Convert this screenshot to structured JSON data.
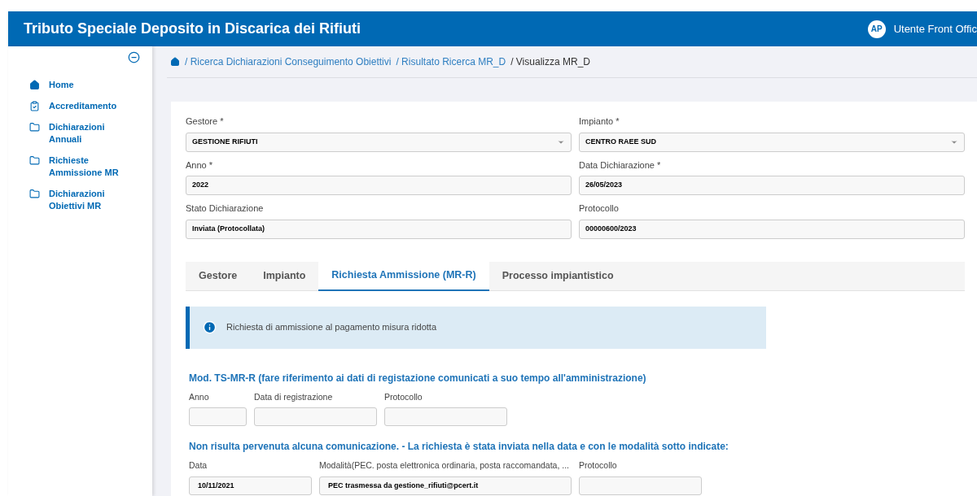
{
  "header": {
    "title": "Tributo Speciale Deposito in Discarica dei Rifiuti",
    "avatar": "AP",
    "user": "Utente Front Offic"
  },
  "sidebar": {
    "items": [
      {
        "label": "Home"
      },
      {
        "label": "Accreditamento"
      },
      {
        "label": "Dichiarazioni Annuali"
      },
      {
        "label": "Richieste Ammissione MR"
      },
      {
        "label": "Dichiarazioni Obiettivi MR"
      }
    ]
  },
  "breadcrumb": {
    "links": [
      "/ Ricerca Dichiarazioni Conseguimento Obiettivi",
      "/ Risultato Ricerca MR_D"
    ],
    "current": "/ Visualizza MR_D"
  },
  "form": {
    "fields": [
      {
        "label": "Gestore *",
        "value": "GESTIONE RIFIUTI",
        "kind": "select"
      },
      {
        "label": "Impianto *",
        "value": "CENTRO RAEE SUD",
        "kind": "select"
      },
      {
        "label": "Anno *",
        "value": "2022",
        "kind": "text"
      },
      {
        "label": "Data Dichiarazione *",
        "value": "26/05/2023",
        "kind": "text"
      },
      {
        "label": "Stato Dichiarazione",
        "value": "Inviata (Protocollata)",
        "kind": "text"
      },
      {
        "label": "Protocollo",
        "value": "00000600/2023",
        "kind": "text"
      }
    ]
  },
  "tabs": [
    {
      "label": "Gestore",
      "selected": false
    },
    {
      "label": "Impianto",
      "selected": false
    },
    {
      "label": "Richiesta Ammissione (MR-R)",
      "selected": true
    },
    {
      "label": "Processo impiantistico",
      "selected": false
    }
  ],
  "info": "Richiesta di ammissione al pagamento misura ridotta",
  "sections": [
    {
      "heading": "Mod. TS-MR-R (fare riferimento ai dati di registazione comunicati a suo tempo all'amministrazione)",
      "fields": [
        {
          "label": "Anno"
        },
        {
          "label": "Data di registrazione"
        },
        {
          "label": "Protocollo"
        }
      ]
    },
    {
      "heading": "Non risulta pervenuta alcuna comunicazione. - La richiesta è stata inviata nella data e con le modalità sotto indicate:",
      "fields": [
        {
          "label": "Data",
          "value": "10/11/2021"
        },
        {
          "label": "Modalità(PEC. posta elettronica ordinaria, posta raccomandata, ...",
          "value": "PEC trasmessa da gestione_rifiuti@pcert.it"
        },
        {
          "label": "Protocollo"
        }
      ]
    }
  ]
}
